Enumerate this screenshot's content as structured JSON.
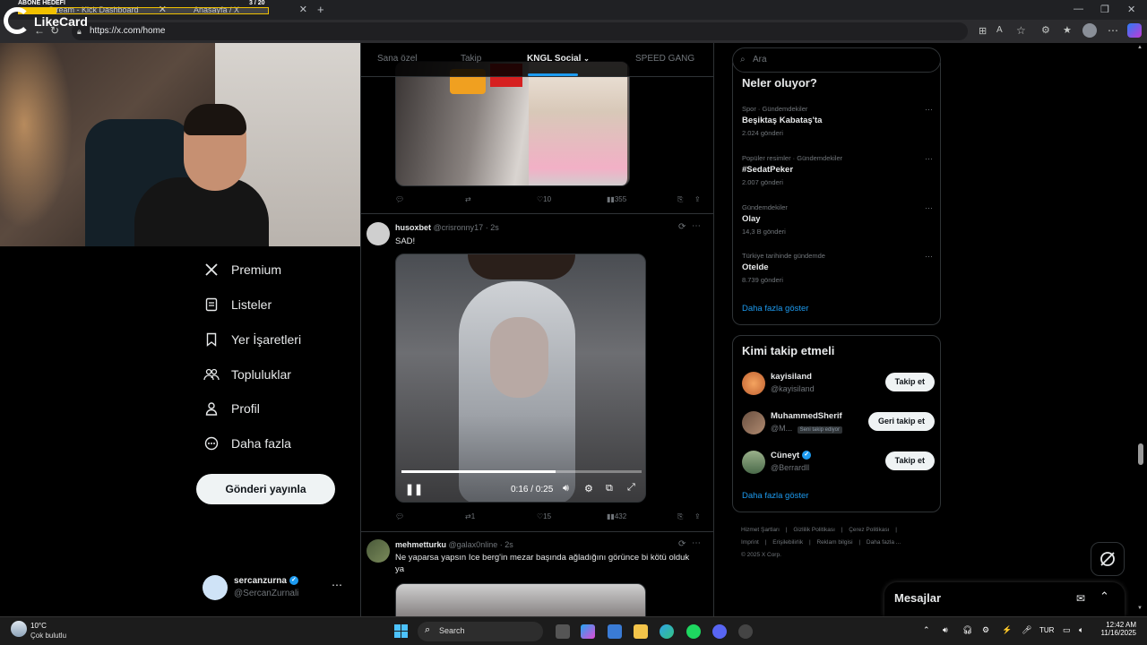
{
  "browser": {
    "tabs": [
      {
        "label": "Stream - Kick Dashboard"
      },
      {
        "label": "Anasayfa / X"
      }
    ],
    "url": "https://x.com/home"
  },
  "stream_overlay": {
    "goal_label": "ABONE HEDEFİ",
    "goal_count": "3 / 20",
    "logo_text": "LikeCard"
  },
  "nav": {
    "items": [
      {
        "label": "Premium",
        "icon": "x-logo-icon"
      },
      {
        "label": "Listeler",
        "icon": "list-icon"
      },
      {
        "label": "Yer İşaretleri",
        "icon": "bookmark-icon"
      },
      {
        "label": "Topluluklar",
        "icon": "communities-icon"
      },
      {
        "label": "Profil",
        "icon": "profile-icon"
      },
      {
        "label": "Daha fazla",
        "icon": "more-circle-icon"
      }
    ],
    "post_button": "Gönderi yayınla",
    "account": {
      "name": "sercanzurna",
      "handle": "@SercanZurnali"
    }
  },
  "feed": {
    "tabs": [
      "Sana özel",
      "Takip",
      "KNGL Social",
      "SPEED GANG"
    ],
    "active_tab": "KNGL Social",
    "tweets": [
      {
        "replies": "",
        "retweets": "",
        "likes": "10",
        "views": "355"
      },
      {
        "name": "husoxbet",
        "handle": "@crisronny17",
        "time": "2s",
        "text": "SAD!",
        "video_time": "0:16 / 0:25",
        "video_progress": 0.64,
        "replies": "",
        "retweets": "1",
        "likes": "15",
        "views": "432"
      },
      {
        "name": "mehmetturku",
        "handle": "@galax0nline",
        "time": "2s",
        "text": "Ne yaparsa yapsın Ice berg'in mezar başında ağladığını görünce bi kötü olduk ya"
      }
    ]
  },
  "search": {
    "placeholder": "Ara"
  },
  "trends": {
    "title": "Neler oluyor?",
    "items": [
      {
        "category": "Spor · Gündemdekiler",
        "title": "Beşiktaş Kabataş'ta",
        "count": "2.024 gönderi"
      },
      {
        "category": "Popüler resimler · Gündemdekiler",
        "title": "#SedatPeker",
        "count": "2.007 gönderi"
      },
      {
        "category": "Gündemdekiler",
        "title": "Olay",
        "count": "14,3 B gönderi"
      },
      {
        "category": "Türkiye tarihinde gündemde",
        "title": "Otelde",
        "count": "8.739 gönderi"
      }
    ],
    "show_more": "Daha fazla göster"
  },
  "who_to_follow": {
    "title": "Kimi takip etmeli",
    "items": [
      {
        "name": "kayisiland",
        "handle": "@kayisiland",
        "button": "Takip et",
        "badge": ""
      },
      {
        "name": "MuhammedSherif",
        "handle": "@M...",
        "button": "Geri takip et",
        "badge": "Seni takip ediyor"
      },
      {
        "name": "Cüneyt",
        "handle": "@Berrardll",
        "button": "Takip et",
        "badge": ""
      }
    ],
    "show_more": "Daha fazla göster"
  },
  "footer": {
    "links": [
      "Hizmet Şartları",
      "Gizlilik Politikası",
      "Çerez Politikası",
      "Imprint",
      "Erişilebilirlik",
      "Reklam bilgisi",
      "Daha fazla ..."
    ],
    "copyright": "© 2025 X Corp."
  },
  "messages": {
    "title": "Mesajlar"
  },
  "taskbar": {
    "weather_temp": "10°C",
    "weather_text": "Çok bulutlu",
    "search": "Search",
    "lang": "TUR",
    "time": "12:42 AM",
    "date": "11/16/2025"
  },
  "colors": {
    "accent": "#1d9bf0",
    "bg": "#000000",
    "border": "#2f3336",
    "muted": "#71767b"
  }
}
